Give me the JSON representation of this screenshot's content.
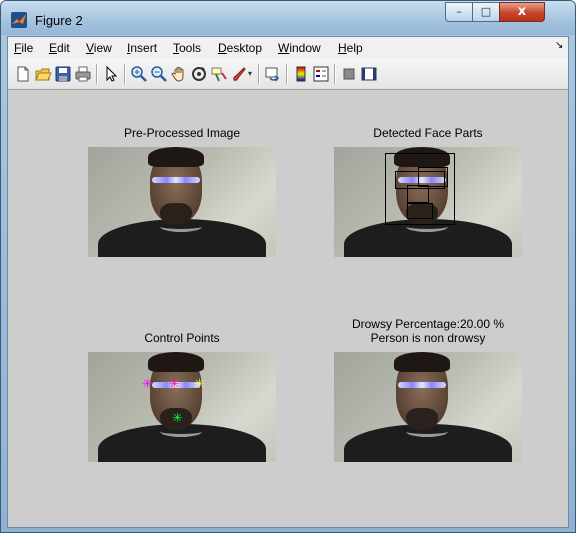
{
  "window": {
    "title": "Figure 2",
    "buttons": {
      "minimize": "–",
      "maximize": "□",
      "close": "x"
    }
  },
  "menubar": {
    "items": [
      "File",
      "Edit",
      "View",
      "Insert",
      "Tools",
      "Desktop",
      "Window",
      "Help"
    ],
    "chevron": "↘"
  },
  "toolbar": {
    "buttons": [
      {
        "icon": "new-figure-icon"
      },
      {
        "icon": "open-file-icon"
      },
      {
        "icon": "save-icon"
      },
      {
        "icon": "print-icon"
      },
      {
        "icon": "edit-plot-arrow-icon"
      },
      {
        "icon": "zoom-in-icon"
      },
      {
        "icon": "zoom-out-icon"
      },
      {
        "icon": "pan-hand-icon"
      },
      {
        "icon": "rotate-3d-icon"
      },
      {
        "icon": "data-cursor-icon"
      },
      {
        "icon": "brush-icon"
      },
      {
        "icon": "link-plot-icon"
      },
      {
        "icon": "colorbar-icon"
      },
      {
        "icon": "legend-icon"
      },
      {
        "icon": "hide-plot-tools-icon"
      },
      {
        "icon": "show-plot-tools-icon"
      }
    ]
  },
  "figure": {
    "panels": [
      {
        "title": "Pre-Processed Image"
      },
      {
        "title": "Detected Face Parts"
      },
      {
        "title": "Control Points"
      },
      {
        "title_line1": "Drowsy Percentage:20.00 %",
        "title_line2": "Person is non drowsy"
      }
    ],
    "control_point_marker": "✳",
    "control_point_colors": [
      "#ff00ff",
      "#ff1493",
      "#ffff66",
      "#00ff33"
    ]
  },
  "colors": {
    "client_background": "#cdcdcd",
    "menubar_background": "#f0f0f0",
    "titlebar": "#a6c4df",
    "close_button": "#c7442c"
  }
}
